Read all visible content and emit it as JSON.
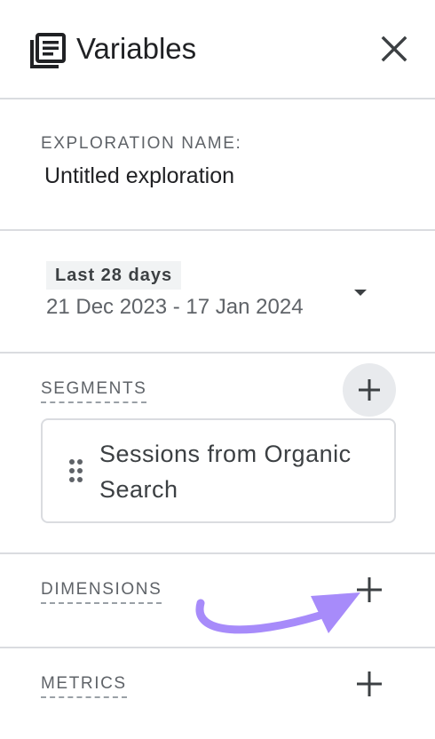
{
  "header": {
    "title": "Variables",
    "icon": "document-list-icon",
    "close_icon": "close-icon"
  },
  "exploration": {
    "label": "EXPLORATION NAME:",
    "value": "Untitled exploration"
  },
  "date": {
    "chip": "Last 28 days",
    "range": "21 Dec 2023 - 17 Jan 2024"
  },
  "segments": {
    "label": "SEGMENTS",
    "items": [
      {
        "label": "Sessions from Organic Search"
      }
    ]
  },
  "dimensions": {
    "label": "DIMENSIONS"
  },
  "metrics": {
    "label": "METRICS"
  },
  "colors": {
    "annotation_arrow": "#a78bfa",
    "divider": "#dadce0",
    "muted_text": "#5f6368"
  }
}
